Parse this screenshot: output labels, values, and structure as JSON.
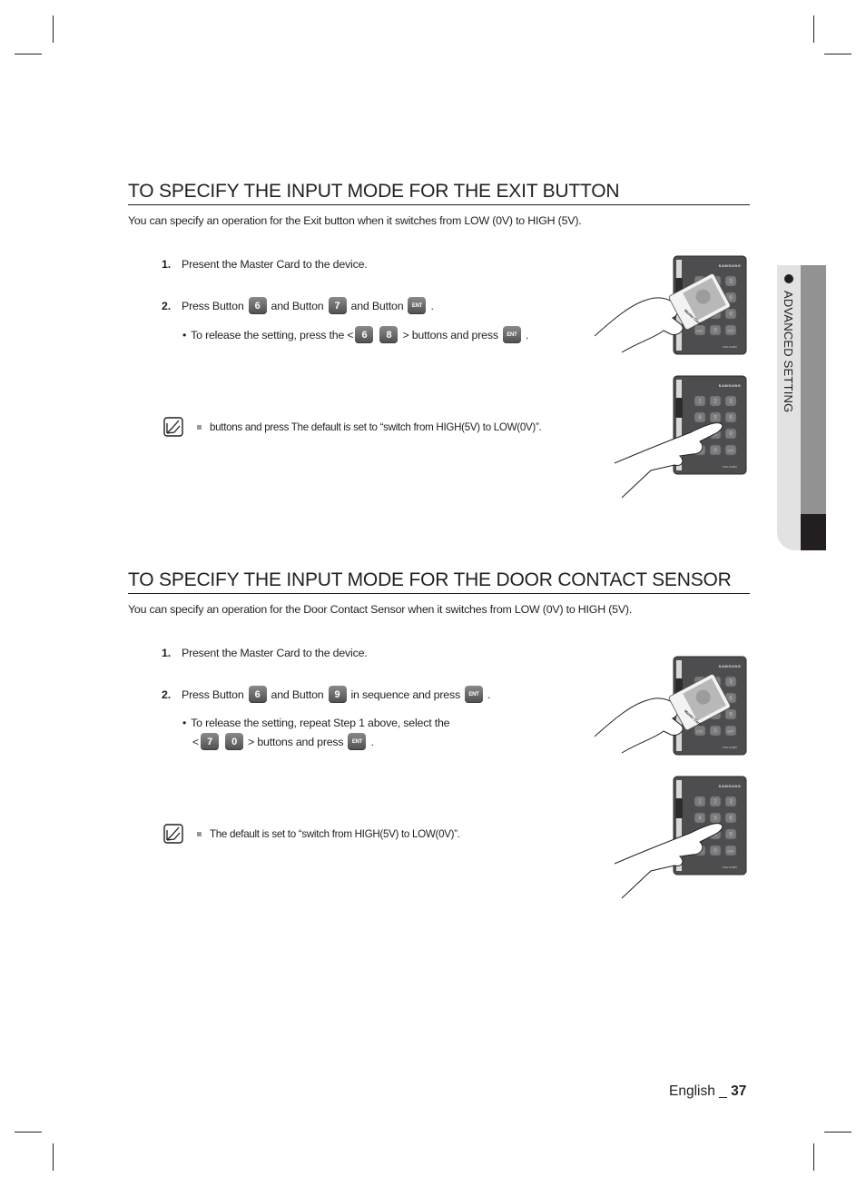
{
  "sections": [
    {
      "title": "TO SPECIFY THE INPUT MODE FOR THE EXIT BUTTON",
      "intro": "You can specify an operation for the Exit button when it switches from LOW (0V) to HIGH (5V).",
      "step1": {
        "num": "1.",
        "text": "Present the Master Card to the device."
      },
      "step2": {
        "num": "2.",
        "t1": "Press Button",
        "k1": "6",
        "t2": "and Button",
        "k2": "7",
        "t3": "and Button",
        "k3": "ENT",
        "t4": "."
      },
      "bullet": {
        "dot": "•",
        "t1": "To release the setting, press the <",
        "k1": "6",
        "k2": "8",
        "t2": "> buttons and press",
        "k3": "ENT",
        "t3": "."
      },
      "note": "buttons and press The default is set to “switch from HIGH(5V) to LOW(0V)”."
    },
    {
      "title": "TO SPECIFY THE INPUT MODE FOR THE DOOR CONTACT SENSOR",
      "intro": "You can specify an operation for the Door Contact Sensor when it switches from LOW (0V) to HIGH (5V).",
      "step1": {
        "num": "1.",
        "text": "Present the Master Card to the device."
      },
      "step2": {
        "num": "2.",
        "t1": "Press Button",
        "k1": "6",
        "t2": "and Button",
        "k2": "9",
        "t3": "in sequence and press",
        "k3": "ENT",
        "t4": "."
      },
      "bullet": {
        "dot": "•",
        "line1": "To release the setting, repeat Step 1 above, select the",
        "t1": "<",
        "k1": "7",
        "k2": "0",
        "t2": "> buttons and press",
        "k3": "ENT",
        "t3": "."
      },
      "note": "The default is set to “switch from HIGH(5V) to LOW(0V)”."
    }
  ],
  "illustration": {
    "brand": "SAMSUNG",
    "card_label": "Master Card",
    "model": "SSA-S2000",
    "keys": [
      "1",
      "2",
      "3",
      "4",
      "5",
      "6",
      "7",
      "8",
      "9",
      "ESC",
      "0",
      "ENT"
    ]
  },
  "side_tab": {
    "label": "ADVANCED SETTING"
  },
  "footer": {
    "language": "English _ ",
    "page": "37"
  },
  "colors": {
    "text": "#231f20",
    "tab_light": "#e2e2e3",
    "tab_mid": "#929292",
    "tab_dark": "#231f20",
    "key": "#5e5e5e"
  }
}
